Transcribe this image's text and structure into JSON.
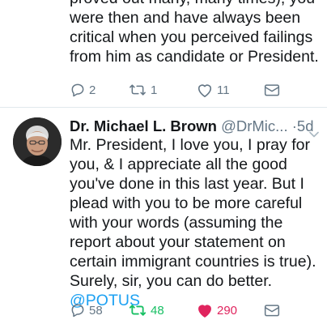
{
  "previous_tweet": {
    "text": "proved out many, many times), you\nwere then and have always been\ncritical when you perceived failings\nfrom him as candidate or President.",
    "actions": {
      "reply_count": "2",
      "retweet_count": "1",
      "like_count": "11"
    }
  },
  "tweet": {
    "display_name": "Dr. Michael L. Brown",
    "handle": "@DrMic...",
    "separator": "·",
    "time": "5d",
    "text": "Mr. President, I love you, I pray for\nyou, & I appreciate all the good\nyou've done in this last year. But I\nplead with you to be more careful\nwith your words (assuming the\nreport about your statement on\ncertain immigrant countries is true).\nSurely, sir, you can do better.",
    "mention": "@POTUS",
    "actions": {
      "reply_count": "58",
      "retweet_count": "48",
      "like_count": "290"
    }
  },
  "colors": {
    "text": "#14171a",
    "secondary": "#657786",
    "link": "#1da1f2",
    "retweet_active": "#17bf63",
    "like_active": "#e0245e",
    "divider": "#e1e8ed"
  },
  "icons": [
    "reply-icon",
    "retweet-icon",
    "like-icon",
    "direct-message-icon",
    "chevron-down-icon"
  ]
}
